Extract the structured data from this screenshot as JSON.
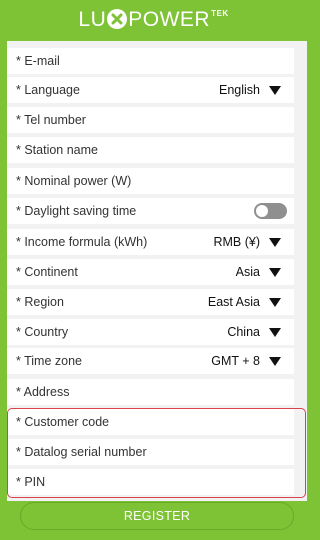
{
  "header": {
    "logo_part1": "LU",
    "logo_part2": "POWER",
    "logo_superscript": "TEK"
  },
  "form": {
    "email_label": "* E-mail",
    "language_label": "* Language",
    "language_value": "English",
    "tel_label": "* Tel number",
    "station_label": "* Station name",
    "nominal_label": "* Nominal power (W)",
    "daylight_label": "* Daylight saving time",
    "daylight_on": false,
    "income_label": "* Income formula (kWh)",
    "income_value": "RMB (¥)",
    "continent_label": "* Continent",
    "continent_value": "Asia",
    "region_label": "* Region",
    "region_value": "East Asia",
    "country_label": "* Country",
    "country_value": "China",
    "timezone_label": "* Time zone",
    "timezone_value": "GMT + 8",
    "address_label": "* Address",
    "customer_label": "* Customer code",
    "datalog_label": "* Datalog serial number",
    "pin_label": "* PIN"
  },
  "register_label": "REGISTER",
  "colors": {
    "brand_green": "#7ec235",
    "highlight_red": "#d9434a",
    "toggle_off": "#8f8f8f"
  }
}
